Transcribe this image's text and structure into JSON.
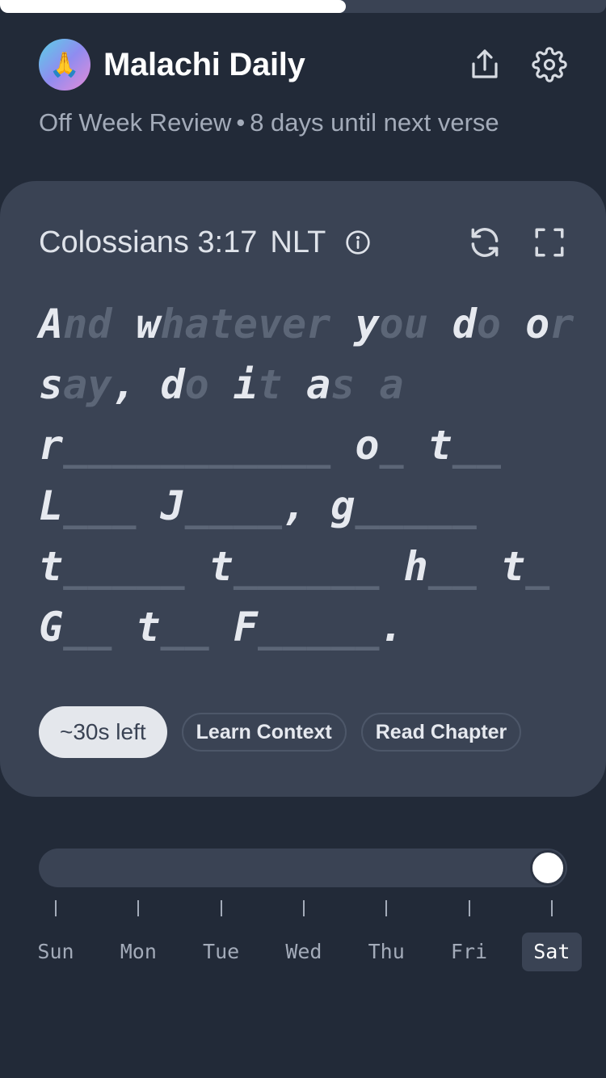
{
  "progress": {
    "fraction": 0.57
  },
  "header": {
    "app_title": "Malachi Daily",
    "app_icon": "🙏",
    "share_icon": "share-icon",
    "settings_icon": "gear-icon"
  },
  "subtitle": {
    "mode": "Off Week Review",
    "separator": "•",
    "countdown": "8 days until next verse"
  },
  "card": {
    "reference": "Colossians 3:17",
    "version": "NLT",
    "verse_lines": [
      [
        {
          "t": "A",
          "b": false
        },
        {
          "t": "nd",
          "b": true
        },
        {
          "t": " w",
          "b": false
        },
        {
          "t": "hatever",
          "b": true
        },
        {
          "t": " y",
          "b": false
        },
        {
          "t": "ou",
          "b": true
        },
        {
          "t": " d",
          "b": false
        },
        {
          "t": "o",
          "b": true
        },
        {
          "t": " o",
          "b": false
        },
        {
          "t": "r",
          "b": true
        }
      ],
      [
        {
          "t": "s",
          "b": false
        },
        {
          "t": "ay",
          "b": true
        },
        {
          "t": ", d",
          "b": false
        },
        {
          "t": "o",
          "b": true
        },
        {
          "t": " i",
          "b": false
        },
        {
          "t": "t",
          "b": true
        },
        {
          "t": " a",
          "b": false
        },
        {
          "t": "s",
          "b": true
        },
        {
          "t": " ",
          "b": false
        },
        {
          "t": "a",
          "b": true
        }
      ],
      [
        {
          "t": "r",
          "b": false
        },
        {
          "t": "___________",
          "b": true
        },
        {
          "t": " o",
          "b": false
        },
        {
          "t": "_",
          "b": true
        },
        {
          "t": " t",
          "b": false
        },
        {
          "t": "__",
          "b": true
        }
      ],
      [
        {
          "t": "L",
          "b": false
        },
        {
          "t": "___",
          "b": true
        },
        {
          "t": " J",
          "b": false
        },
        {
          "t": "____",
          "b": true
        },
        {
          "t": ", g",
          "b": false
        },
        {
          "t": "_____",
          "b": true
        }
      ],
      [
        {
          "t": "t",
          "b": false
        },
        {
          "t": "_____",
          "b": true
        },
        {
          "t": " t",
          "b": false
        },
        {
          "t": "______",
          "b": true
        },
        {
          "t": " h",
          "b": false
        },
        {
          "t": "__",
          "b": true
        },
        {
          "t": " t",
          "b": false
        },
        {
          "t": "_",
          "b": true
        }
      ],
      [
        {
          "t": "G",
          "b": false
        },
        {
          "t": "__",
          "b": true
        },
        {
          "t": " t",
          "b": false
        },
        {
          "t": "__",
          "b": true
        },
        {
          "t": " F",
          "b": false
        },
        {
          "t": "_____",
          "b": true
        },
        {
          "t": ".",
          "b": false
        }
      ]
    ],
    "timer_label": "~30s left",
    "learn_context_label": "Learn Context",
    "read_chapter_label": "Read Chapter"
  },
  "week_slider": {
    "value_fraction": 1.0,
    "days": [
      "Sun",
      "Mon",
      "Tue",
      "Wed",
      "Thu",
      "Fri",
      "Sat"
    ],
    "selected_index": 6
  },
  "colors": {
    "background": "#222a38",
    "card": "#3a4354",
    "text": "#e6e9ef",
    "muted": "#a3abb9"
  }
}
